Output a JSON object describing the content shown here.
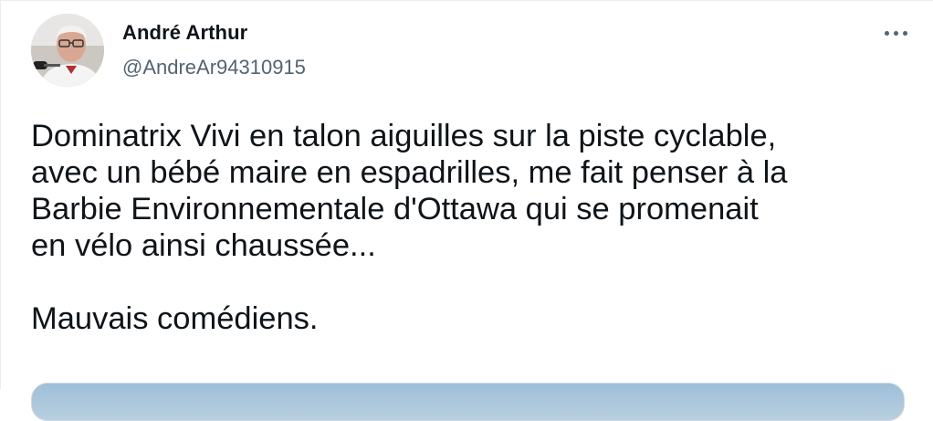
{
  "tweet": {
    "author_name": "André Arthur",
    "author_handle": "@AndreAr94310915",
    "text_lines": [
      "Dominatrix Vivi en talon aiguilles sur la piste cyclable,",
      "avec un bébé maire en espadrilles, me fait penser à la",
      "Barbie Environnementale d'Ottawa qui se promenait",
      "en vélo ainsi chaussée..."
    ],
    "text_last": "Mauvais comédiens.",
    "more_icon": "more-horizontal-icon"
  }
}
